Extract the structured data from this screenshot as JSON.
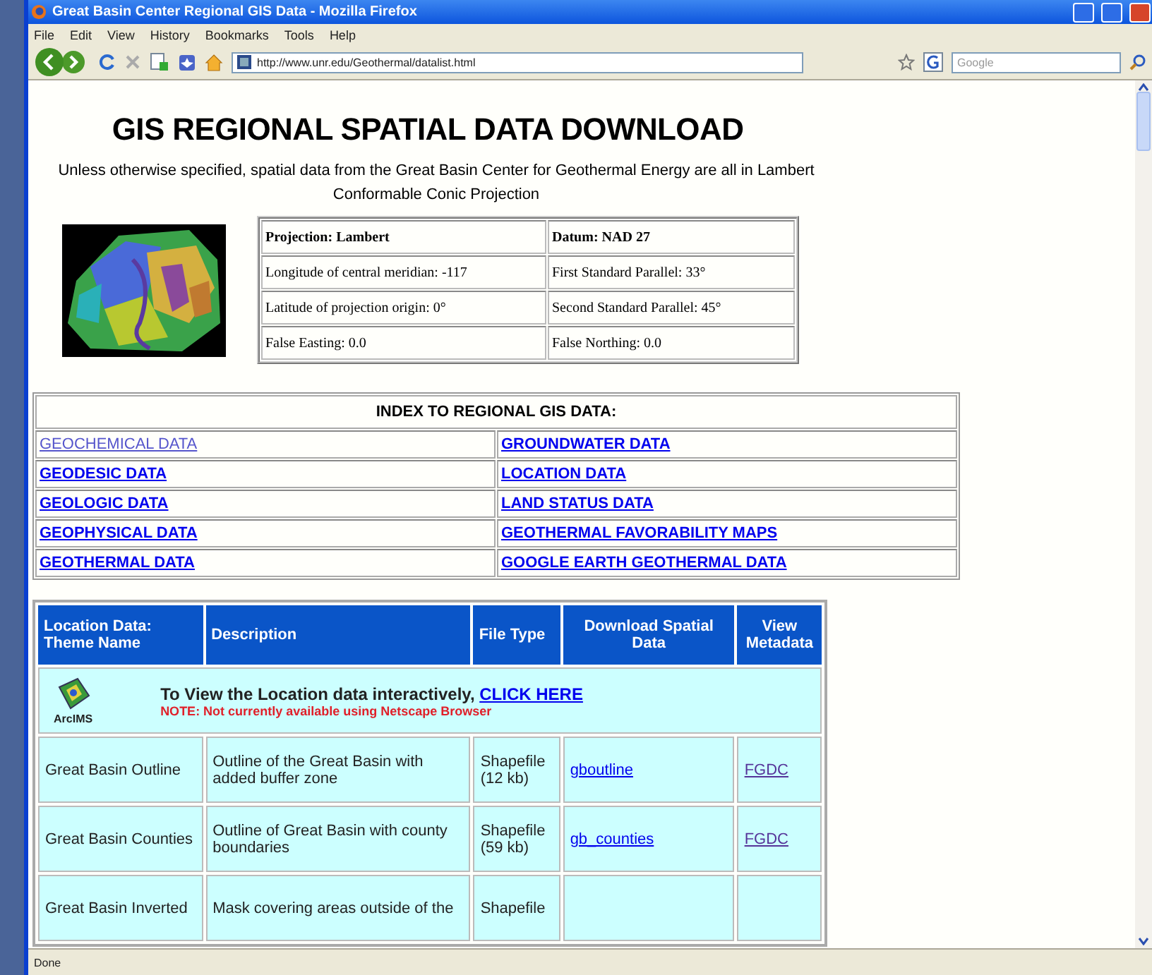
{
  "window": {
    "title": "Great Basin Center Regional GIS Data - Mozilla Firefox",
    "menu": [
      "File",
      "Edit",
      "View",
      "History",
      "Bookmarks",
      "Tools",
      "Help"
    ],
    "url": "http://www.unr.edu/Geothermal/datalist.html",
    "search_placeholder": "Google",
    "status": "Done"
  },
  "page": {
    "heading": "GIS REGIONAL SPATIAL DATA DOWNLOAD",
    "intro": "Unless otherwise specified, spatial data from the Great Basin Center for Geothermal Energy are all in Lambert Conformable Conic Projection",
    "projection_table": [
      [
        "Projection: Lambert",
        "Datum: NAD 27"
      ],
      [
        "Longitude of central meridian: -117",
        "First Standard Parallel: 33°"
      ],
      [
        "Latitude of projection origin: 0°",
        "Second Standard Parallel: 45°"
      ],
      [
        "False Easting: 0.0",
        "False Northing: 0.0"
      ]
    ],
    "index": {
      "title": "INDEX TO REGIONAL GIS DATA:",
      "links": [
        {
          "label": "GEOCHEMICAL DATA",
          "visited": true
        },
        {
          "label": "GROUNDWATER DATA",
          "visited": false
        },
        {
          "label": "GEODESIC DATA",
          "visited": false
        },
        {
          "label": "LOCATION DATA",
          "visited": false
        },
        {
          "label": "GEOLOGIC DATA",
          "visited": false
        },
        {
          "label": "LAND STATUS DATA",
          "visited": false
        },
        {
          "label": "GEOPHYSICAL DATA",
          "visited": false
        },
        {
          "label": "GEOTHERMAL FAVORABILITY MAPS",
          "visited": false
        },
        {
          "label": "GEOTHERMAL DATA",
          "visited": false
        },
        {
          "label": "GOOGLE EARTH GEOTHERMAL DATA",
          "visited": false
        }
      ]
    },
    "data_table": {
      "columns": [
        "Location Data: Theme Name",
        "Description",
        "File Type",
        "Download Spatial Data",
        "View Metadata"
      ],
      "banner": {
        "icon_label": "ArcIMS",
        "text": "To View the Location data interactively, ",
        "link": "CLICK HERE",
        "note": "NOTE: Not currently available using Netscape Browser"
      },
      "rows": [
        {
          "theme": "Great Basin Outline",
          "description": "Outline of the Great Basin with added buffer zone",
          "file_type": "Shapefile (12 kb)",
          "download": {
            "label": "gboutline",
            "visited": false
          },
          "metadata": {
            "label": "FGDC",
            "visited": true
          }
        },
        {
          "theme": "Great Basin Counties",
          "description": "Outline of Great Basin with county boundaries",
          "file_type": "Shapefile (59 kb)",
          "download": {
            "label": "gb_counties",
            "visited": false
          },
          "metadata": {
            "label": "FGDC",
            "visited": true
          }
        },
        {
          "theme": "Great Basin Inverted",
          "description": "Mask covering areas outside of the",
          "file_type": "Shapefile"
        }
      ]
    }
  }
}
